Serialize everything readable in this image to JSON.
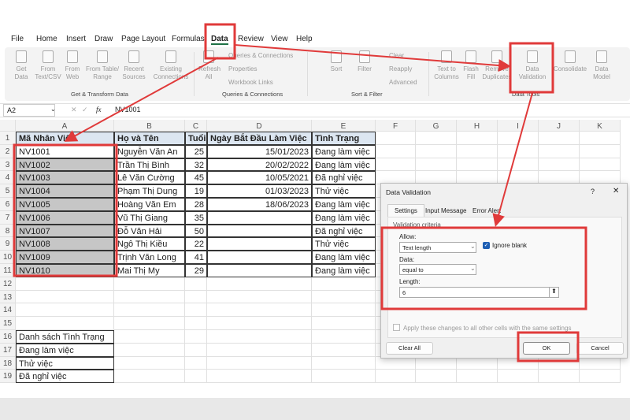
{
  "tabs": [
    "File",
    "Home",
    "Insert",
    "Draw",
    "Page Layout",
    "Formulas",
    "Data",
    "Review",
    "View",
    "Help"
  ],
  "ribbon": {
    "buttons": [
      "Get Data",
      "From Text/CSV",
      "From Web",
      "From Table/ Range",
      "Recent Sources",
      "Existing Connections",
      "Refresh All",
      "Sort",
      "Filter",
      "Text to Columns",
      "Flash Fill",
      "Remove Duplicates",
      "Data Validation",
      "Consolidate",
      "Data Model"
    ],
    "queries": [
      "Queries & Connections",
      "Properties",
      "Workbook Links"
    ],
    "filter_small": [
      "Clear",
      "Reapply",
      "Advanced"
    ],
    "groups": [
      "Get & Transform Data",
      "Queries & Connections",
      "Sort & Filter",
      "Data Tools"
    ]
  },
  "formula_bar": {
    "name_box": "A2",
    "fx": "fx",
    "value": "NV1001"
  },
  "columns": [
    "A",
    "B",
    "C",
    "D",
    "E",
    "F",
    "G",
    "H",
    "I",
    "J",
    "K"
  ],
  "rows": [
    [
      "Mã Nhân Viên",
      "Họ và Tên",
      "Tuổi",
      "Ngày Bắt Đầu Làm Việc",
      "Tình Trạng"
    ],
    [
      "NV1001",
      "Nguyễn Văn An",
      "25",
      "15/01/2023",
      "Đang làm việc"
    ],
    [
      "NV1002",
      "Trần Thị Bình",
      "32",
      "20/02/2022",
      "Đang làm việc"
    ],
    [
      "NV1003",
      "Lê Văn Cường",
      "45",
      "10/05/2021",
      "Đã nghỉ việc"
    ],
    [
      "NV1004",
      "Phạm Thị Dung",
      "19",
      "01/03/2023",
      "Thử việc"
    ],
    [
      "NV1005",
      "Hoàng Văn Em",
      "28",
      "18/06/2023",
      "Đang làm việc"
    ],
    [
      "NV1006",
      "Vũ Thị Giang",
      "35",
      "",
      "Đang làm việc"
    ],
    [
      "NV1007",
      "Đỗ Văn Hải",
      "50",
      "",
      "Đã nghỉ việc"
    ],
    [
      "NV1008",
      "Ngô Thị Kiều",
      "22",
      "",
      "Thử việc"
    ],
    [
      "NV1009",
      "Trịnh Văn Long",
      "41",
      "",
      "Đang làm việc"
    ],
    [
      "NV1010",
      "Mai Thị My",
      "29",
      "",
      "Đang làm việc"
    ]
  ],
  "status_list": [
    "Danh sách Tình Trạng",
    "Đang làm việc",
    "Thử việc",
    "Đã nghỉ việc"
  ],
  "dialog": {
    "title": "Data Validation",
    "help": "?",
    "close": "✕",
    "tabs": [
      "Settings",
      "Input Message",
      "Error Alert"
    ],
    "section": "Validation criteria",
    "allow_label": "Allow:",
    "allow_value": "Text length",
    "ignore_blank": "Ignore blank",
    "ignore_blank_checked": true,
    "data_label": "Data:",
    "data_value": "equal to",
    "length_label": "Length:",
    "length_value": "6",
    "apply_all": "Apply these changes to all other cells with the same settings",
    "clear_all": "Clear All",
    "ok": "OK",
    "cancel": "Cancel"
  },
  "annotation_color": "#e03a3a"
}
